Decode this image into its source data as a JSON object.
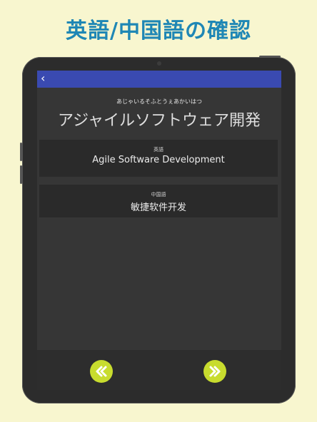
{
  "promo": {
    "title": "英語/中国語の確認"
  },
  "header": {
    "back_icon": "chevron-left-icon",
    "back_glyph": "‹"
  },
  "term": {
    "reading": "あじゃいるそふとうぇあかいはつ",
    "japanese": "アジャイルソフトウェア開発"
  },
  "english_card": {
    "label": "英語",
    "value": "Agile Software Development"
  },
  "chinese_card": {
    "label": "中国語",
    "value": "敏捷软件开发"
  },
  "nav": {
    "prev_icon": "double-chevron-left-icon",
    "next_icon": "double-chevron-right-icon"
  },
  "colors": {
    "accent": "#1f87b5",
    "appbar": "#3a4ab1",
    "nav_button": "#c8dc2e",
    "background": "#f8f6cf"
  }
}
